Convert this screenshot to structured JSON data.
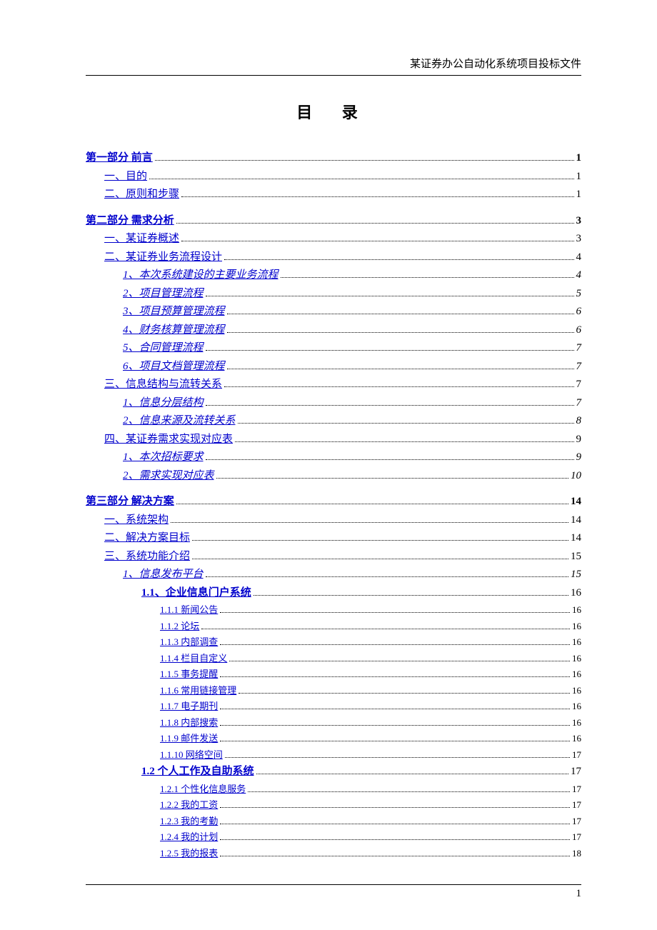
{
  "header": "某证券办公自动化系统项目投标文件",
  "title": "目 录",
  "footer_page": "1",
  "toc": [
    {
      "label": "第一部分 前言",
      "page": "1",
      "level": 0,
      "cls": "bold section-gap"
    },
    {
      "label": "一、目的",
      "page": "1",
      "level": 1
    },
    {
      "label": "二、原则和步骤",
      "page": "1",
      "level": 1
    },
    {
      "label": "第二部分 需求分析",
      "page": "3",
      "level": 0,
      "cls": "bold section-gap"
    },
    {
      "label": "一、某证券概述",
      "page": "3",
      "level": 1
    },
    {
      "label": "二、某证券业务流程设计",
      "page": "4",
      "level": 1
    },
    {
      "label": "1、本次系统建设的主要业务流程",
      "page": "4",
      "level": 2,
      "cls": "italic"
    },
    {
      "label": "2、项目管理流程",
      "page": "5",
      "level": 2,
      "cls": "italic"
    },
    {
      "label": "3、项目预算管理流程",
      "page": "6",
      "level": 2,
      "cls": "italic"
    },
    {
      "label": "4、财务核算管理流程",
      "page": "6",
      "level": 2,
      "cls": "italic"
    },
    {
      "label": "5、合同管理流程",
      "page": "7",
      "level": 2,
      "cls": "italic"
    },
    {
      "label": "6、项目文档管理流程",
      "page": "7",
      "level": 2,
      "cls": "italic"
    },
    {
      "label": "三、信息结构与流转关系",
      "page": "7",
      "level": 1
    },
    {
      "label": "1、信息分层结构",
      "page": "7",
      "level": 2,
      "cls": "italic"
    },
    {
      "label": "2、信息来源及流转关系",
      "page": "8",
      "level": 2,
      "cls": "italic"
    },
    {
      "label": "四、某证券需求实现对应表",
      "page": "9",
      "level": 1
    },
    {
      "label": "1、本次招标要求",
      "page": "9",
      "level": 2,
      "cls": "italic"
    },
    {
      "label": "2、需求实现对应表",
      "page": "10",
      "level": 2,
      "cls": "italic"
    },
    {
      "label": "第三部分 解决方案",
      "page": "14",
      "level": 0,
      "cls": "bold section-gap"
    },
    {
      "label": "一、系统架构",
      "page": "14",
      "level": 1
    },
    {
      "label": "二、解决方案目标",
      "page": "14",
      "level": 1
    },
    {
      "label": "三、系统功能介绍",
      "page": "15",
      "level": 1
    },
    {
      "label": "1、信息发布平台",
      "page": "15",
      "level": 2,
      "cls": "italic"
    },
    {
      "label": "1.1、企业信息门户系统",
      "page": "16",
      "level": 3,
      "cls": "l3bold"
    },
    {
      "label": "1.1.1 新闻公告",
      "page": "16",
      "level": 4,
      "cls": "small"
    },
    {
      "label": "1.1.2 论坛",
      "page": "16",
      "level": 4,
      "cls": "small"
    },
    {
      "label": "1.1.3 内部调查",
      "page": "16",
      "level": 4,
      "cls": "small"
    },
    {
      "label": "1.1.4 栏目自定义",
      "page": "16",
      "level": 4,
      "cls": "small"
    },
    {
      "label": "1.1.5 事务提醒",
      "page": "16",
      "level": 4,
      "cls": "small"
    },
    {
      "label": "1.1.6 常用链接管理",
      "page": "16",
      "level": 4,
      "cls": "small"
    },
    {
      "label": "1.1.7 电子期刊",
      "page": "16",
      "level": 4,
      "cls": "small"
    },
    {
      "label": "1.1.8 内部搜索",
      "page": "16",
      "level": 4,
      "cls": "small"
    },
    {
      "label": "1.1.9 邮件发送",
      "page": "16",
      "level": 4,
      "cls": "small"
    },
    {
      "label": "1.1.10 网络空间",
      "page": "17",
      "level": 4,
      "cls": "small"
    },
    {
      "label": "1.2 个人工作及自助系统",
      "page": "17",
      "level": 3,
      "cls": "l3bold"
    },
    {
      "label": "1.2.1 个性化信息服务",
      "page": "17",
      "level": 4,
      "cls": "small"
    },
    {
      "label": "1.2.2 我的工资",
      "page": "17",
      "level": 4,
      "cls": "small"
    },
    {
      "label": "1.2.3 我的考勤",
      "page": "17",
      "level": 4,
      "cls": "small"
    },
    {
      "label": "1.2.4 我的计划",
      "page": "17",
      "level": 4,
      "cls": "small"
    },
    {
      "label": "1.2.5 我的报表",
      "page": "18",
      "level": 4,
      "cls": "small"
    }
  ]
}
